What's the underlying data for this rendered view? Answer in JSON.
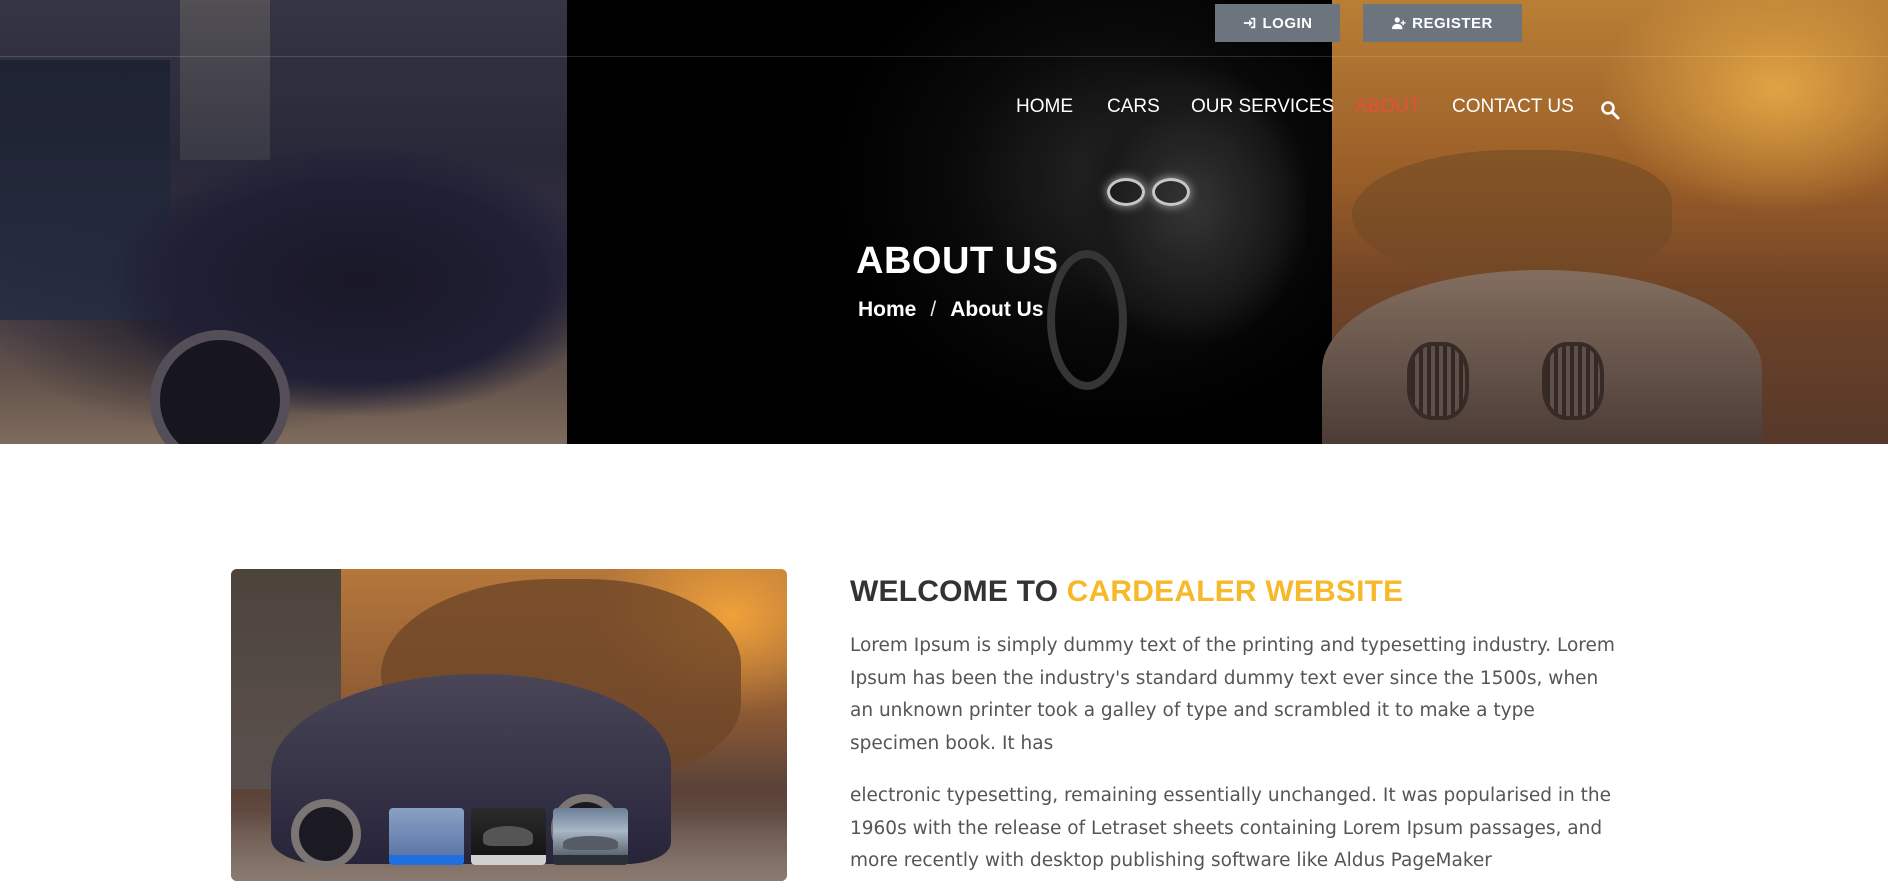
{
  "header": {
    "login_label": "LOGIN",
    "register_label": "REGISTER",
    "login_icon": "sign-in-icon",
    "register_icon": "user-plus-icon"
  },
  "nav": {
    "items": [
      {
        "label": "HOME",
        "active": false
      },
      {
        "label": "CARS",
        "active": false
      },
      {
        "label": "OUR SERVICES",
        "active": false
      },
      {
        "label": "ABOUT",
        "active": true
      },
      {
        "label": "CONTACT US",
        "active": false
      }
    ],
    "search_icon": "search-icon"
  },
  "hero": {
    "title": "ABOUT US",
    "breadcrumb": {
      "home": "Home",
      "separator": "/",
      "current": "About Us"
    }
  },
  "about": {
    "heading_prefix": "WELCOME TO",
    "heading_accent": "CARDEALER WEBSITE",
    "paragraph_1": "Lorem Ipsum is simply dummy text of the printing and typesetting industry. Lorem Ipsum has been the industry's standard dummy text ever since the 1500s, when an unknown printer took a galley of type and scrambled it to make a type specimen book. It has",
    "paragraph_2": "electronic typesetting, remaining essentially unchanged. It was popularised in the 1960s with the release of Letraset sheets containing Lorem Ipsum passages, and more recently with desktop publishing software like Aldus PageMaker"
  },
  "colors": {
    "accent_yellow": "#f7b92a",
    "nav_active": "#e94d3b",
    "button_gray": "#6c757d",
    "thumb_active": "#1f6fe0"
  }
}
